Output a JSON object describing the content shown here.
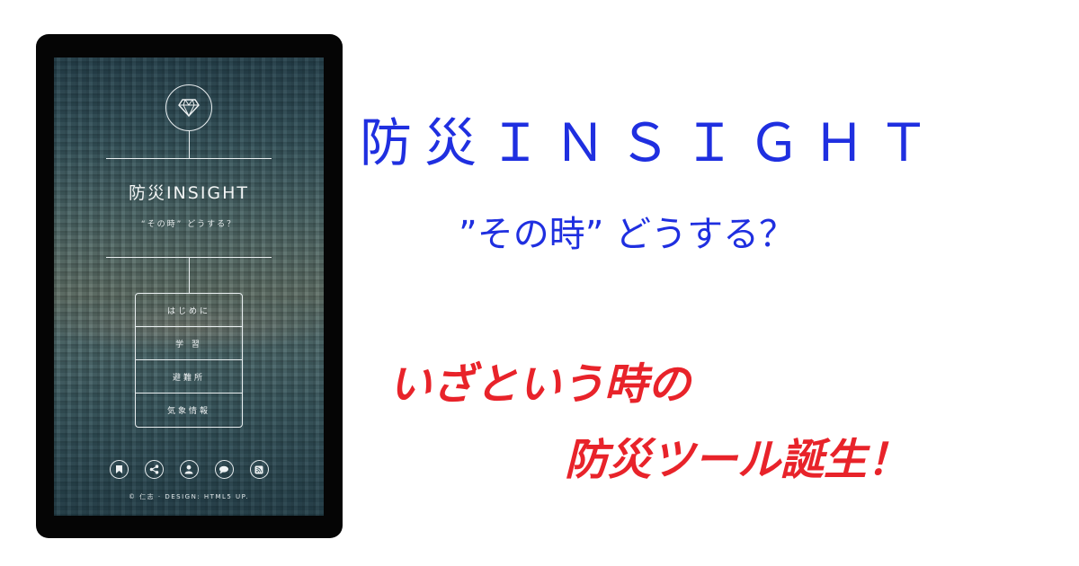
{
  "promo": {
    "title": "防災ＩＮＳＩＧＨＴ",
    "tagline": "”その時” どうする？",
    "line1": "いざという時の",
    "line2": "防災ツール誕生！"
  },
  "colors": {
    "title_blue": "#1f2fe0",
    "promo_red": "#e8232a",
    "tablet_frame": "#050505"
  },
  "app": {
    "logo_icon": "diamond-icon",
    "title": "防災INSIGHT",
    "subtitle": "“その時” どうする？",
    "menu": [
      {
        "label": "はじめに"
      },
      {
        "label": "学 習"
      },
      {
        "label": "避難所"
      },
      {
        "label": "気象情報"
      }
    ],
    "social_icons": [
      "bookmark-icon",
      "share-icon",
      "user-icon",
      "chat-icon",
      "rss-icon"
    ],
    "footer": "© 仁志 · DESIGN: HTML5 UP."
  }
}
